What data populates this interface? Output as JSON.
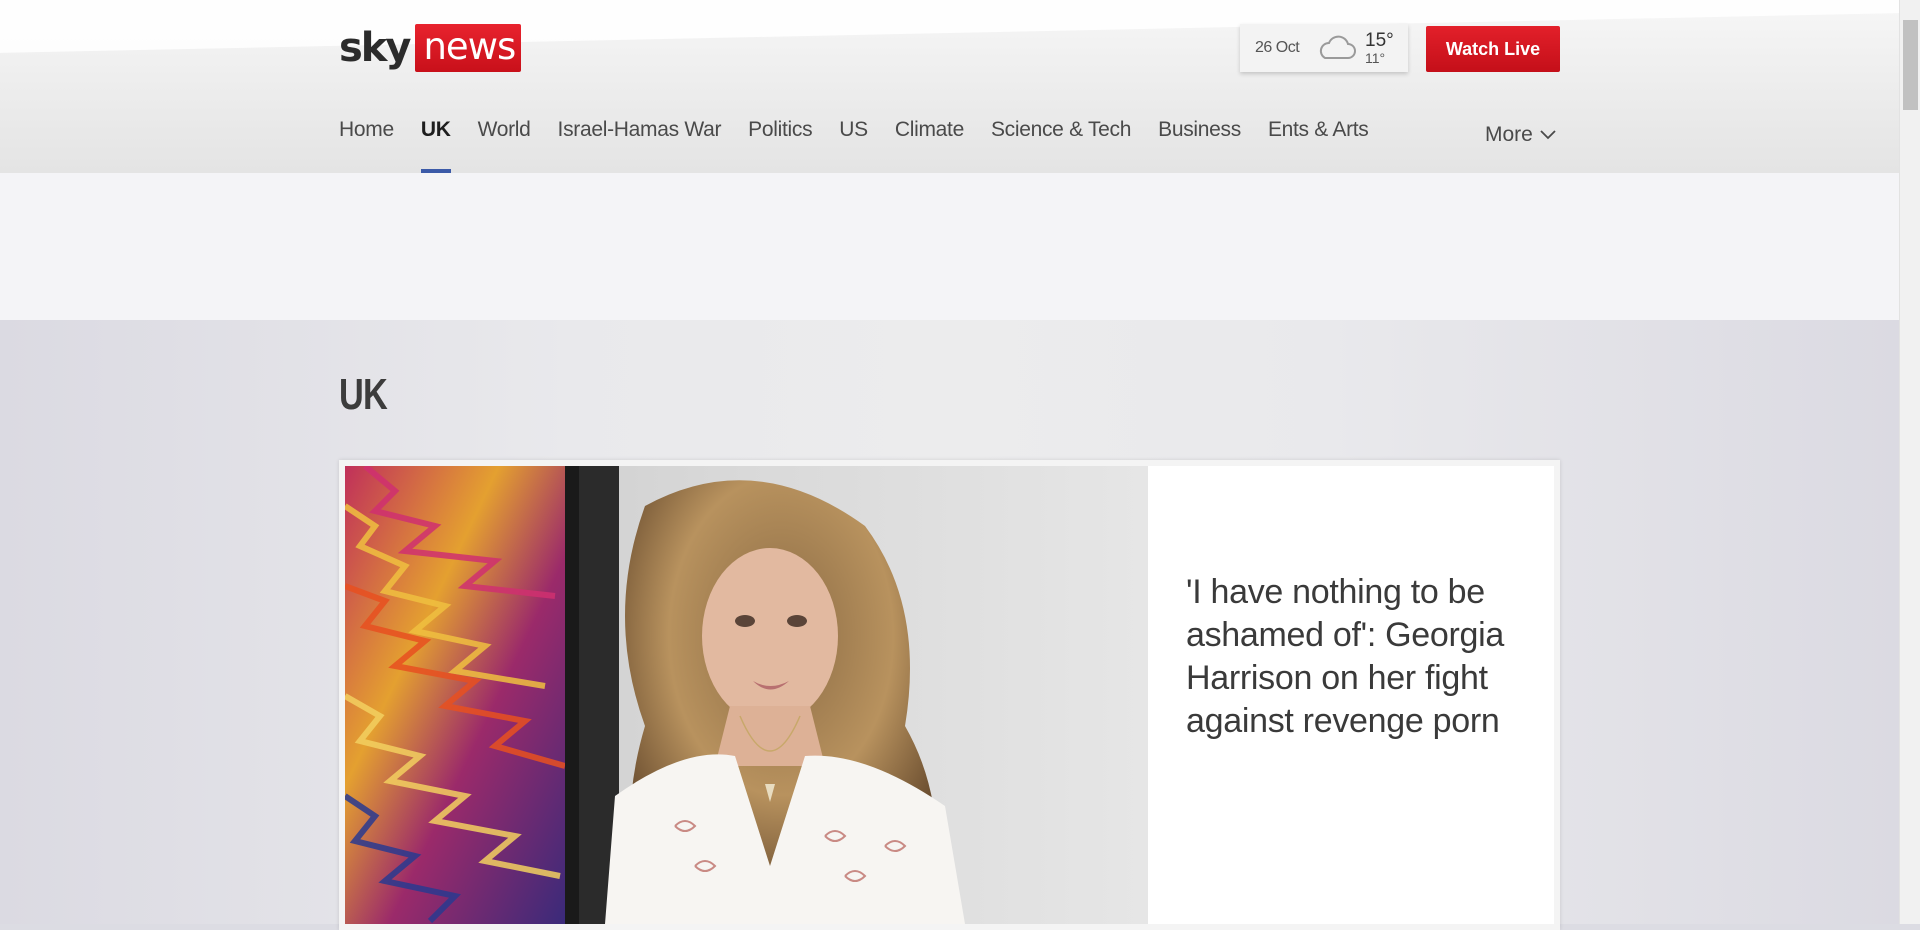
{
  "brand": {
    "logo_sky": "sky",
    "logo_news": "news",
    "accent": "#d3131e"
  },
  "weather": {
    "date": "26 Oct",
    "icon": "cloud-icon",
    "high": "15°",
    "low": "11°"
  },
  "watch_live_label": "Watch Live",
  "nav": {
    "items": [
      {
        "label": "Home",
        "active": false
      },
      {
        "label": "UK",
        "active": true
      },
      {
        "label": "World",
        "active": false
      },
      {
        "label": "Israel-Hamas War",
        "active": false
      },
      {
        "label": "Politics",
        "active": false
      },
      {
        "label": "US",
        "active": false
      },
      {
        "label": "Climate",
        "active": false
      },
      {
        "label": "Science & Tech",
        "active": false
      },
      {
        "label": "Business",
        "active": false
      },
      {
        "label": "Ents & Arts",
        "active": false
      }
    ],
    "more_label": "More",
    "active_underline_color": "#3b5aa8"
  },
  "main": {
    "title": "UK",
    "lead_story": {
      "headline": "'I have nothing to be ashamed of': Georgia Harrison on her fight against revenge porn"
    }
  }
}
